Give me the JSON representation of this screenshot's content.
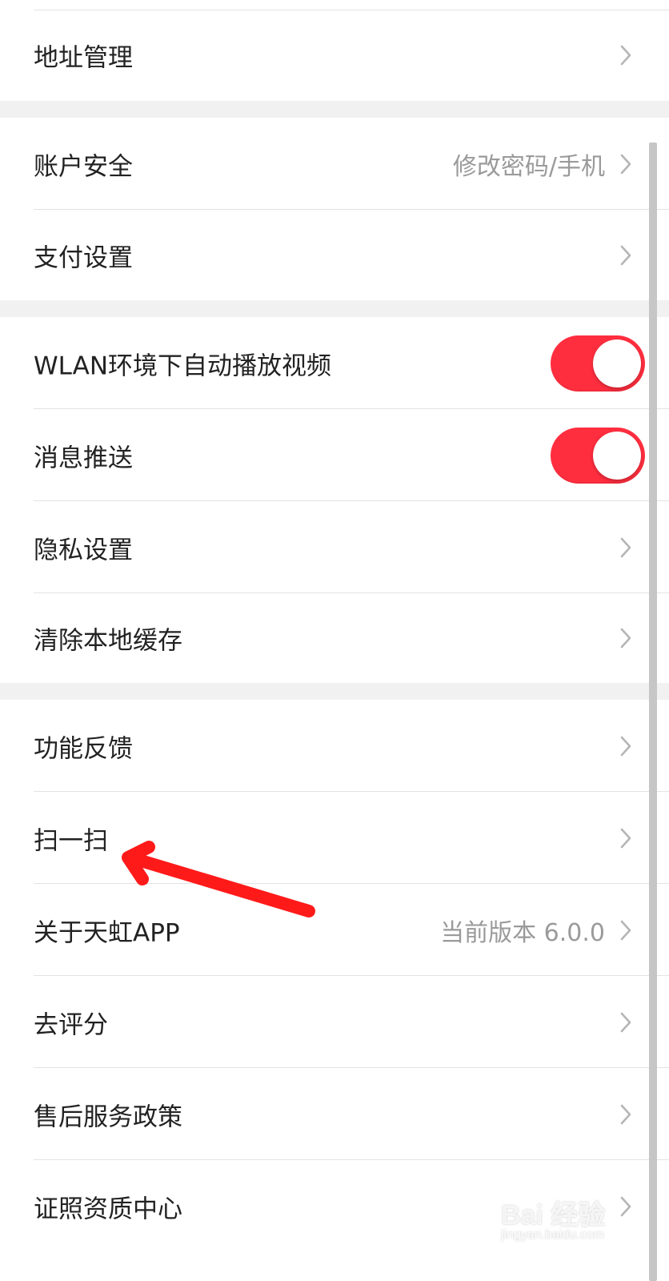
{
  "colors": {
    "background": "#f1f1f1",
    "card": "#ffffff",
    "divider": "#e3e3e3",
    "text": "#222222",
    "secondary_text": "#9a9a9a",
    "toggle_on": "#ff2e3f",
    "annotation_arrow": "#ff1a1a",
    "scrollbar": "#c6c6c6"
  },
  "settings": {
    "group1": [
      {
        "label": "地址管理",
        "value": "",
        "control": "chevron"
      }
    ],
    "group2": [
      {
        "label": "账户安全",
        "value": "修改密码/手机",
        "control": "chevron"
      },
      {
        "label": "支付设置",
        "value": "",
        "control": "chevron"
      }
    ],
    "group3": [
      {
        "label": "WLAN环境下自动播放视频",
        "control": "toggle",
        "state": "on"
      },
      {
        "label": "消息推送",
        "control": "toggle",
        "state": "on"
      },
      {
        "label": "隐私设置",
        "value": "",
        "control": "chevron"
      },
      {
        "label": "清除本地缓存",
        "value": "",
        "control": "chevron"
      }
    ],
    "group4": [
      {
        "label": "功能反馈",
        "value": "",
        "control": "chevron"
      },
      {
        "label": "扫一扫",
        "value": "",
        "control": "chevron"
      },
      {
        "label": "关于天虹APP",
        "value": "当前版本 6.0.0",
        "control": "chevron"
      },
      {
        "label": "去评分",
        "value": "",
        "control": "chevron"
      },
      {
        "label": "售后服务政策",
        "value": "",
        "control": "chevron"
      },
      {
        "label": "证照资质中心",
        "value": "",
        "control": "chevron"
      }
    ]
  },
  "icons": {
    "chevron": "chevron-right-icon",
    "arrow": "annotation-arrow-icon"
  },
  "watermark": {
    "main": "Bai 经验",
    "sub": "jingyan.baidu.com"
  }
}
